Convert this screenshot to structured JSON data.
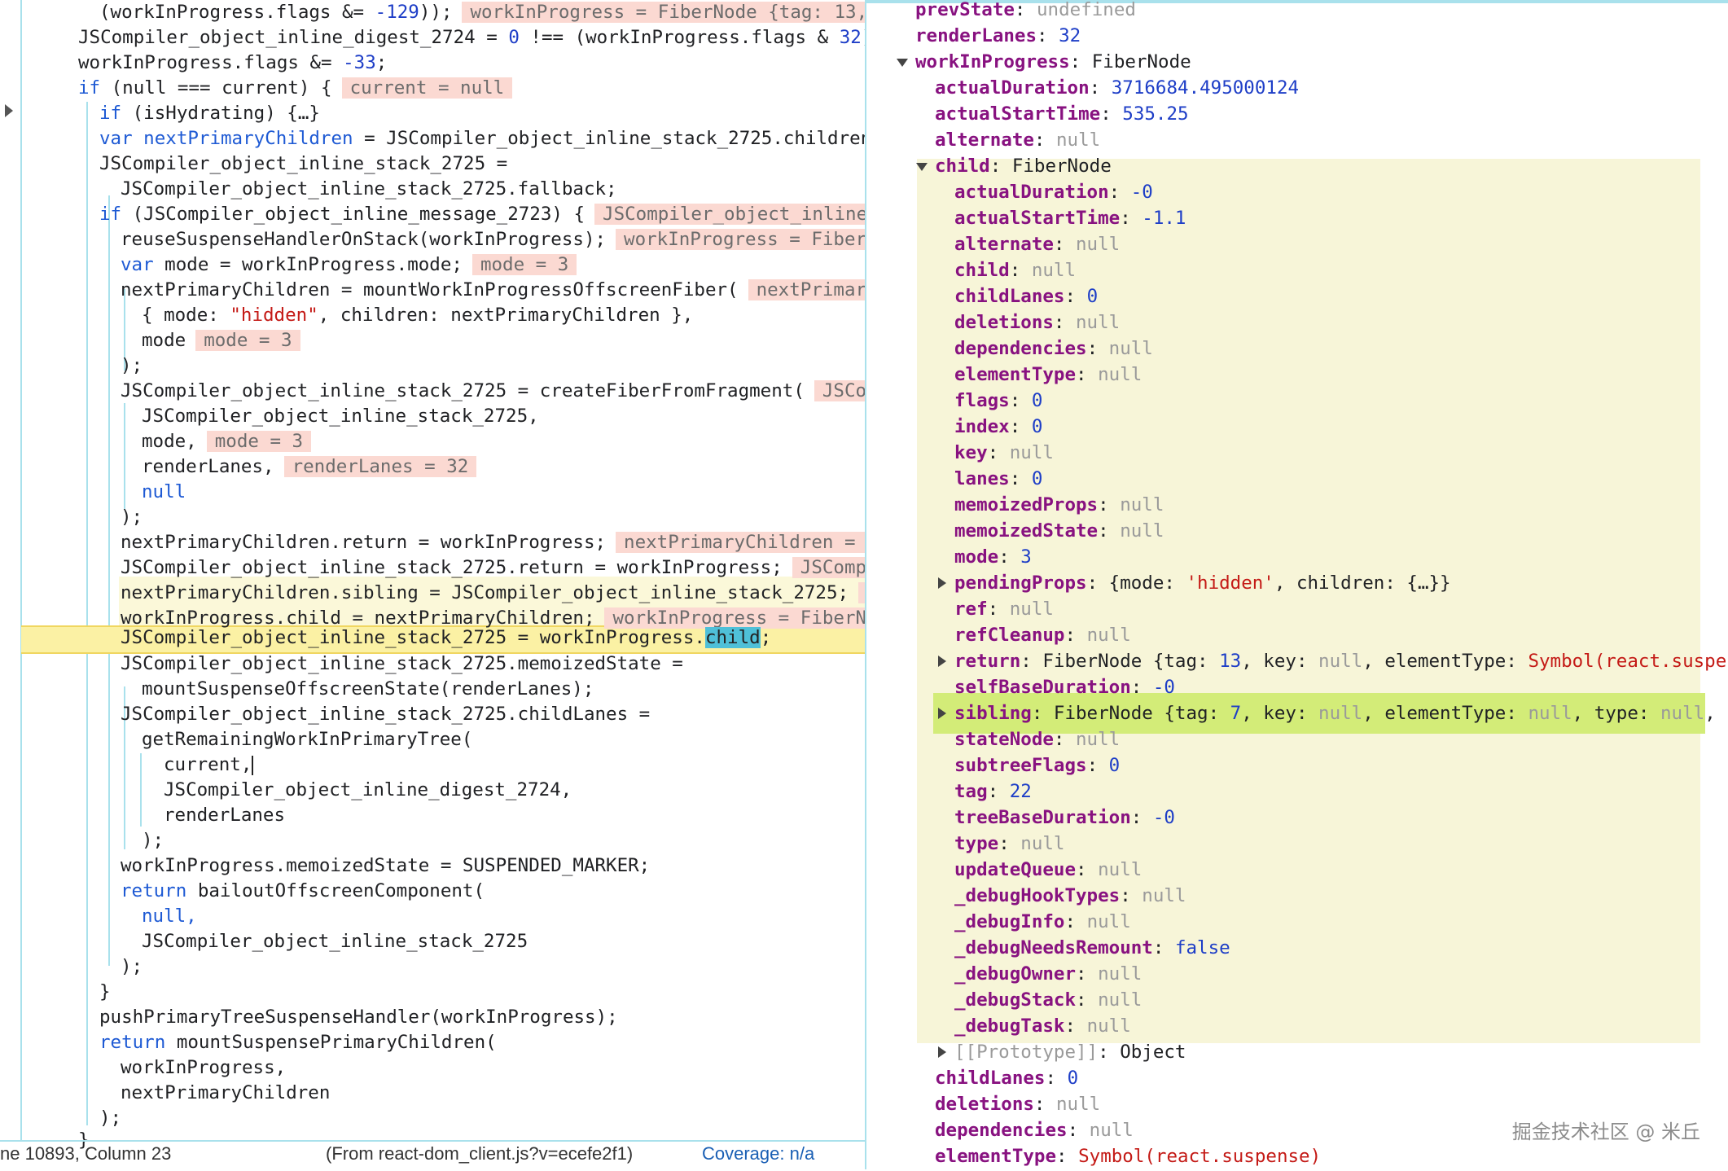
{
  "code": {
    "lines": {
      "l01": "(workInProgress.flags &= ",
      "l01n": "-129",
      "l01e": "));",
      "l01v": "workInProgress = FiberNode {tag: 13,",
      "l02": "JSCompiler_object_inline_digest_2724 = ",
      "l02n0": "0",
      "l02m": " !== (workInProgress.flags & ",
      "l02n1": "32",
      "l02e": ");",
      "l03": "workInProgress.flags &= ",
      "l03n": "-33",
      "l03e": ";",
      "l04k": "if",
      "l04": " (null === current) {",
      "l04v": "current = null",
      "l05k": "if",
      "l05": " (isHydrating) {…}",
      "l06k": "var",
      "l06n": " nextPrimaryChildren",
      "l06": " = JSCompiler_object_inline_stack_2725.children;",
      "l07": "JSCompiler_object_inline_stack_2725 =",
      "l08": "JSCompiler_object_inline_stack_2725.fallback;",
      "l09k": "if",
      "l09": " (JSCompiler_object_inline_message_2723) {",
      "l09v": "JSCompiler_object_inline_",
      "l10": "reuseSuspenseHandlerOnStack(workInProgress);",
      "l10v": "workInProgress = FiberN",
      "l11k": "var",
      "l11": " mode = workInProgress.mode;",
      "l11v": "mode = 3",
      "l12": "nextPrimaryChildren = mountWorkInProgressOffscreenFiber(",
      "l12v": "nextPrimary",
      "l13a": "{ mode: ",
      "l13s": "\"hidden\"",
      "l13b": ", children: nextPrimaryChildren },",
      "l14": "mode",
      "l14v": "mode = 3",
      "l15": ");",
      "l16": "JSCompiler_object_inline_stack_2725 = createFiberFromFragment(",
      "l16v": "JSCom",
      "l17": "JSCompiler_object_inline_stack_2725,",
      "l18": "mode,",
      "l18v": "mode = 3",
      "l19": "renderLanes,",
      "l19v": "renderLanes = 32",
      "l20": "null",
      "l21": ");",
      "l22": "nextPrimaryChildren.return = workInProgress;",
      "l22v": "nextPrimaryChildren = F",
      "l23": "JSCompiler_object_inline_stack_2725.return = workInProgress;",
      "l23v": "JSCompi",
      "l24": "nextPrimaryChildren.sibling = JSCompiler_object_inline_stack_2725;",
      "l24v": "r",
      "l25": "workInProgress.child = nextPrimaryChildren;",
      "l25v": "workInProgress = FiberNo",
      "l26a": "JSCompiler_object_inline_stack_2725 = workInProgress.",
      "l26s": "child",
      "l26e": ";",
      "l27": "JSCompiler_object_inline_stack_2725.memoizedState =",
      "l28": "mountSuspenseOffscreenState(renderLanes);",
      "l29": "JSCompiler_object_inline_stack_2725.childLanes =",
      "l30": "getRemainingWorkInPrimaryTree(",
      "l31": "current,",
      "l32": "JSCompiler_object_inline_digest_2724,",
      "l33": "renderLanes",
      "l34": ");",
      "l35": "workInProgress.memoizedState = SUSPENDED_MARKER;",
      "l36k": "return",
      "l36": " bailoutOffscreenComponent(",
      "l37": "null,",
      "l38": "JSCompiler_object_inline_stack_2725",
      "l39": ");",
      "l40": "}",
      "l41": "pushPrimaryTreeSuspenseHandler(workInProgress);",
      "l42k": "return",
      "l42": " mountSuspensePrimaryChildren(",
      "l43": "workInProgress,",
      "l44": "nextPrimaryChildren",
      "l45": ");",
      "l46": "}"
    }
  },
  "status_bar": {
    "position": "ne 10893, Column 23",
    "source": "(From react-dom_client.js?v=ecefe2f1)",
    "coverage": "Coverage: n/a"
  },
  "scope": {
    "rows": {
      "r00k": "prevState",
      "r00v": "undefined",
      "r01k": "renderLanes",
      "r01v": "32",
      "r02k": "workInProgress",
      "r02v": "FiberNode",
      "r03k": "actualDuration",
      "r03v": "3716684.495000124",
      "r04k": "actualStartTime",
      "r04v": "535.25",
      "r05k": "alternate",
      "r05v": "null",
      "r06k": "child",
      "r06v": "FiberNode",
      "r07k": "actualDuration",
      "r07v": "-0",
      "r08k": "actualStartTime",
      "r08v": "-1.1",
      "r09k": "alternate",
      "r09v": "null",
      "r10k": "child",
      "r10v": "null",
      "r11k": "childLanes",
      "r11v": "0",
      "r12k": "deletions",
      "r12v": "null",
      "r13k": "dependencies",
      "r13v": "null",
      "r14k": "elementType",
      "r14v": "null",
      "r15k": "flags",
      "r15v": "0",
      "r16k": "index",
      "r16v": "0",
      "r17k": "key",
      "r17v": "null",
      "r18k": "lanes",
      "r18v": "0",
      "r19k": "memoizedProps",
      "r19v": "null",
      "r20k": "memoizedState",
      "r20v": "null",
      "r21k": "mode",
      "r21v": "3",
      "r22k": "pendingProps",
      "r22a": "{mode: ",
      "r22s": "'hidden'",
      "r22b": ", children: {…}}",
      "r23k": "ref",
      "r23v": "null",
      "r24k": "refCleanup",
      "r24v": "null",
      "r25k": "return",
      "r25a": "FiberNode {tag: ",
      "r25n": "13",
      "r25b": ", key: ",
      "r25c": "null",
      "r25d": ", elementType: ",
      "r25s": "Symbol(react.suspens",
      "r26k": "selfBaseDuration",
      "r26v": "-0",
      "r27k": "sibling",
      "r27a": "FiberNode {tag: ",
      "r27n": "7",
      "r27b": ", key: ",
      "r27c": "null",
      "r27d": ", elementType: ",
      "r27e": "null",
      "r27f": ", type: ",
      "r27g": "null",
      "r27h": ", st",
      "r28k": "stateNode",
      "r28v": "null",
      "r29k": "subtreeFlags",
      "r29v": "0",
      "r30k": "tag",
      "r30v": "22",
      "r31k": "treeBaseDuration",
      "r31v": "-0",
      "r32k": "type",
      "r32v": "null",
      "r33k": "updateQueue",
      "r33v": "null",
      "r34k": "_debugHookTypes",
      "r34v": "null",
      "r35k": "_debugInfo",
      "r35v": "null",
      "r36k": "_debugNeedsRemount",
      "r36v": "false",
      "r37k": "_debugOwner",
      "r37v": "null",
      "r38k": "_debugStack",
      "r38v": "null",
      "r39k": "_debugTask",
      "r39v": "null",
      "r40k": "[[Prototype]]",
      "r40v": "Object",
      "r41k": "childLanes",
      "r41v": "0",
      "r42k": "deletions",
      "r42v": "null",
      "r43k": "dependencies",
      "r43v": "null",
      "r44k": "elementType",
      "r44v": "Symbol(react.suspense)"
    }
  },
  "watermark": "掘金技术社区 @ 米丘",
  "colors": {
    "keyword": "#1e5ad4",
    "number": "#1e3ec7",
    "string": "#c41a16",
    "property": "#881280",
    "inline_value_bg": "#fbd9d2",
    "current_line_bg": "#fbf1a4",
    "selection_bg": "#4fc0d8",
    "child_scope_bg": "#f7f5d8",
    "sibling_highlight": "#d3ec78"
  }
}
